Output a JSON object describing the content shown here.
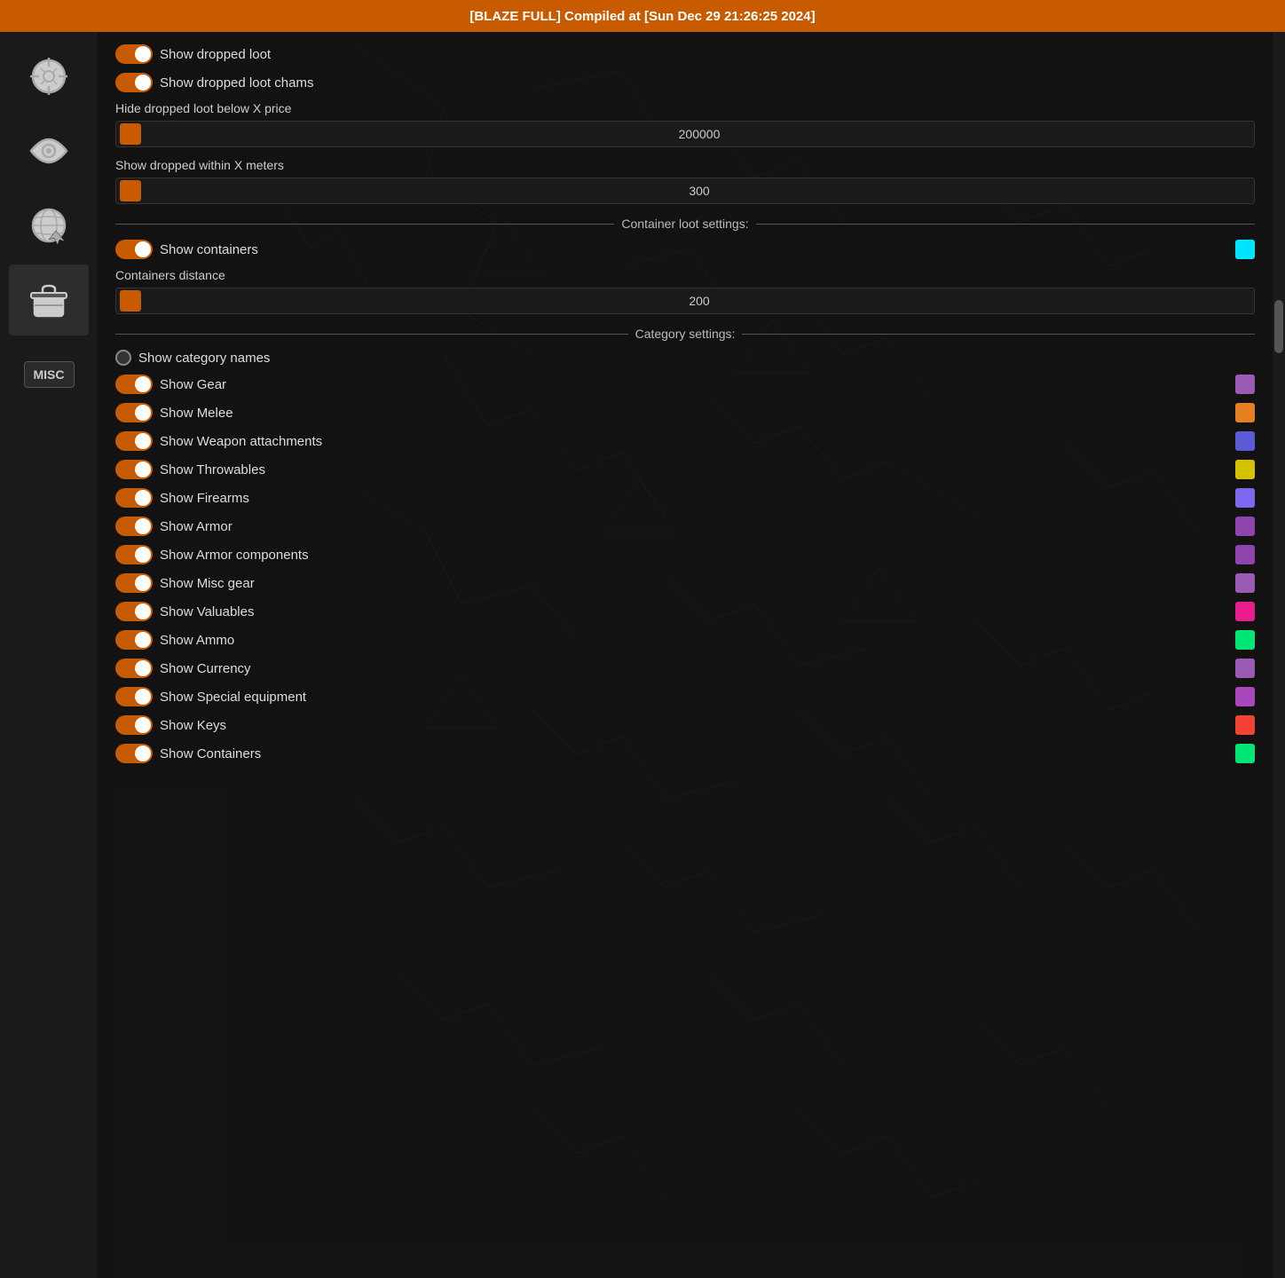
{
  "titleBar": {
    "text": "[BLAZE FULL] Compiled at [Sun Dec 29 21:26:25 2024]"
  },
  "sidebar": {
    "items": [
      {
        "id": "crosshair",
        "label": "Aimbot",
        "icon": "crosshair"
      },
      {
        "id": "eye",
        "label": "Visuals",
        "icon": "eye"
      },
      {
        "id": "globe",
        "label": "World",
        "icon": "globe"
      },
      {
        "id": "bag",
        "label": "Loot",
        "icon": "bag",
        "active": true
      },
      {
        "id": "misc",
        "label": "MISC",
        "icon": "misc-text"
      }
    ]
  },
  "panel": {
    "droppedLoot": {
      "showDroppedLoot": {
        "label": "Show dropped loot",
        "enabled": true
      },
      "showDroppedLootChams": {
        "label": "Show dropped loot chams",
        "enabled": true
      },
      "hideBelowPriceLabel": "Hide dropped loot below X price",
      "hideBelowPrice": "200000",
      "showWithinLabel": "Show dropped within X meters",
      "showWithin": "300"
    },
    "containerSection": {
      "title": "Container loot settings:",
      "showContainers": {
        "label": "Show containers",
        "enabled": true,
        "color": "#00e5ff"
      },
      "containersDistanceLabel": "Containers distance",
      "containersDistance": "200"
    },
    "categorySection": {
      "title": "Category settings:",
      "showCategoryNames": {
        "label": "Show category names",
        "enabled": false
      },
      "items": [
        {
          "label": "Show Gear",
          "enabled": true,
          "color": "#9b59b6"
        },
        {
          "label": "Show Melee",
          "enabled": true,
          "color": "#e67e22"
        },
        {
          "label": "Show Weapon attachments",
          "enabled": true,
          "color": "#5b5bd6"
        },
        {
          "label": "Show Throwables",
          "enabled": true,
          "color": "#d4c200"
        },
        {
          "label": "Show Firearms",
          "enabled": true,
          "color": "#7b68ee"
        },
        {
          "label": "Show Armor",
          "enabled": true,
          "color": "#8e44ad"
        },
        {
          "label": "Show Armor components",
          "enabled": true,
          "color": "#8e44ad"
        },
        {
          "label": "Show Misc gear",
          "enabled": true,
          "color": "#9b59b6"
        },
        {
          "label": "Show Valuables",
          "enabled": true,
          "color": "#e91e8c"
        },
        {
          "label": "Show Ammo",
          "enabled": true,
          "color": "#00e676"
        },
        {
          "label": "Show Currency",
          "enabled": true,
          "color": "#9b59b6"
        },
        {
          "label": "Show Special equipment",
          "enabled": true,
          "color": "#ab47bc"
        },
        {
          "label": "Show Keys",
          "enabled": true,
          "color": "#f44336"
        },
        {
          "label": "Show Containers",
          "enabled": true,
          "color": "#00e676"
        }
      ]
    }
  }
}
